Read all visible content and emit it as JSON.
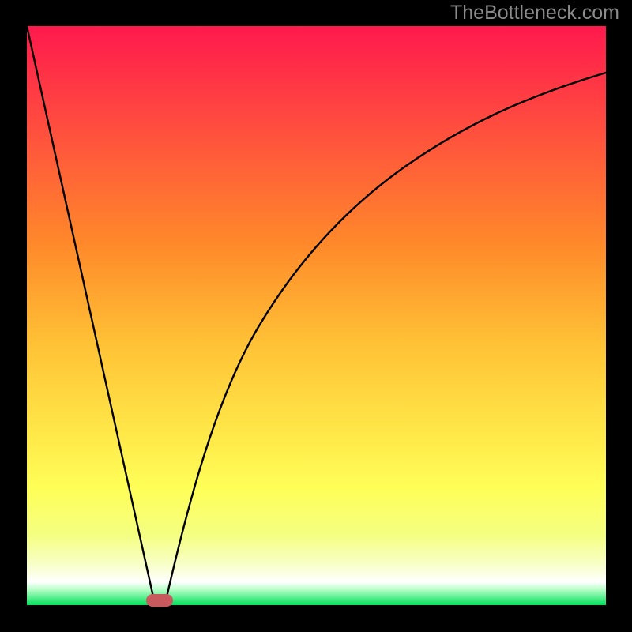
{
  "watermark": "TheBottleneck.com",
  "chart_data": {
    "type": "line",
    "title": "",
    "xlabel": "",
    "ylabel": "",
    "xlim": [
      0,
      100
    ],
    "ylim": [
      0,
      100
    ],
    "background_gradient": {
      "top": "#ff194d",
      "mid_upper": "#ff8a2a",
      "mid": "#ffd23a",
      "mid_lower": "#ffff58",
      "lower": "#f1ff8f",
      "base_fade": "#ffffff",
      "bottom": "#00e05a"
    },
    "series": [
      {
        "name": "left-descent",
        "x": [
          0,
          22
        ],
        "y": [
          100,
          0
        ],
        "style": "linear"
      },
      {
        "name": "right-ascent-curve",
        "x": [
          24,
          28,
          32,
          36,
          40,
          45,
          50,
          55,
          60,
          65,
          70,
          75,
          80,
          85,
          90,
          95,
          100
        ],
        "y": [
          0,
          17,
          30,
          40,
          48,
          56,
          63,
          68,
          73,
          77,
          80.5,
          83.5,
          86,
          88,
          89.5,
          90.8,
          92
        ],
        "style": "curved"
      }
    ],
    "marker": {
      "name": "optimal-region",
      "x_center": 23,
      "y": 0,
      "width_x_units": 4.6
    },
    "axes_visible": false,
    "grid": false
  },
  "colors": {
    "frame": "#000000",
    "curve": "#000000",
    "marker": "#c85a5e",
    "watermark": "#8b8b8b"
  }
}
